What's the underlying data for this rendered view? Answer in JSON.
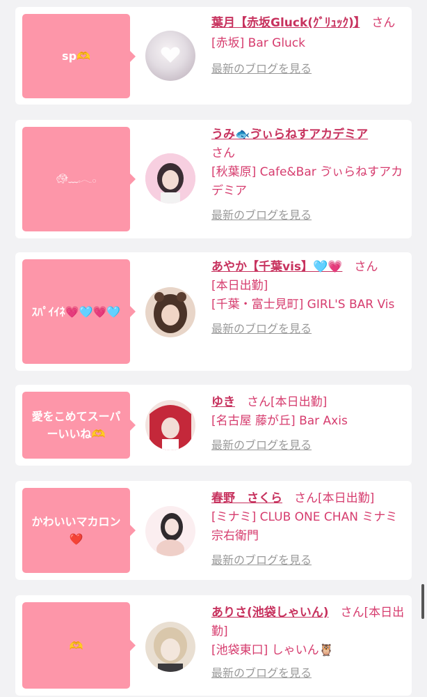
{
  "entries": [
    {
      "message": "sp🫶",
      "name": "葉月【赤坂Gluck(ｸﾞﾘｭｯｸ)】",
      "suffix": "さん",
      "shop": "[赤坂] Bar Gluck",
      "blog_link": "最新のブログを見る",
      "avatar_colors": [
        "#e9e4ea",
        "#c9bcc6"
      ]
    },
    {
      "message": "🐢︎﹏𓈒𓂃𓂂",
      "name": "うみ🐟ゔぃらねすアカデミア",
      "suffix": "さん",
      "shop": "[秋葉原] Cafe&Bar ゔぃらねすアカデミア",
      "blog_link": "最新のブログを見る",
      "avatar_colors": [
        "#f5c8da",
        "#3a2d33"
      ]
    },
    {
      "message": "ｽﾊﾟｲｲﾈ💗🩵💗🩵",
      "name": "あやか【千葉vis】🩵💗",
      "suffix": "さん",
      "status": "[本日出勤]",
      "shop": "[千葉・富士見町] GIRL'S BAR Vis",
      "blog_link": "最新のブログを見る",
      "avatar_colors": [
        "#d9b9a6",
        "#4a3328"
      ]
    },
    {
      "message": "愛をこめてスーパーいいね🫶",
      "name": "ゆき",
      "suffix": "さん",
      "status": "[本日出勤]",
      "shop": "[名古屋 藤が丘] Bar Axis",
      "blog_link": "最新のブログを見る",
      "avatar_colors": [
        "#c4283a",
        "#f0d9d3"
      ]
    },
    {
      "message": "かわいいマカロン❤️",
      "name": "春野　さくら",
      "suffix": "さん",
      "status": "[本日出勤]",
      "shop": "[ミナミ] CLUB ONE CHAN ミナミ 宗右衛門",
      "blog_link": "最新のブログを見る",
      "avatar_colors": [
        "#fbeef0",
        "#e7c4c0"
      ]
    },
    {
      "message": "🫶",
      "name": "ありさ(池袋しゃいん)",
      "suffix": "さん",
      "status": "[本日出勤]",
      "shop": "[池袋東口] しゃいん🦉",
      "blog_link": "最新のブログを見る",
      "avatar_colors": [
        "#efe3cf",
        "#9c8a78"
      ]
    }
  ]
}
